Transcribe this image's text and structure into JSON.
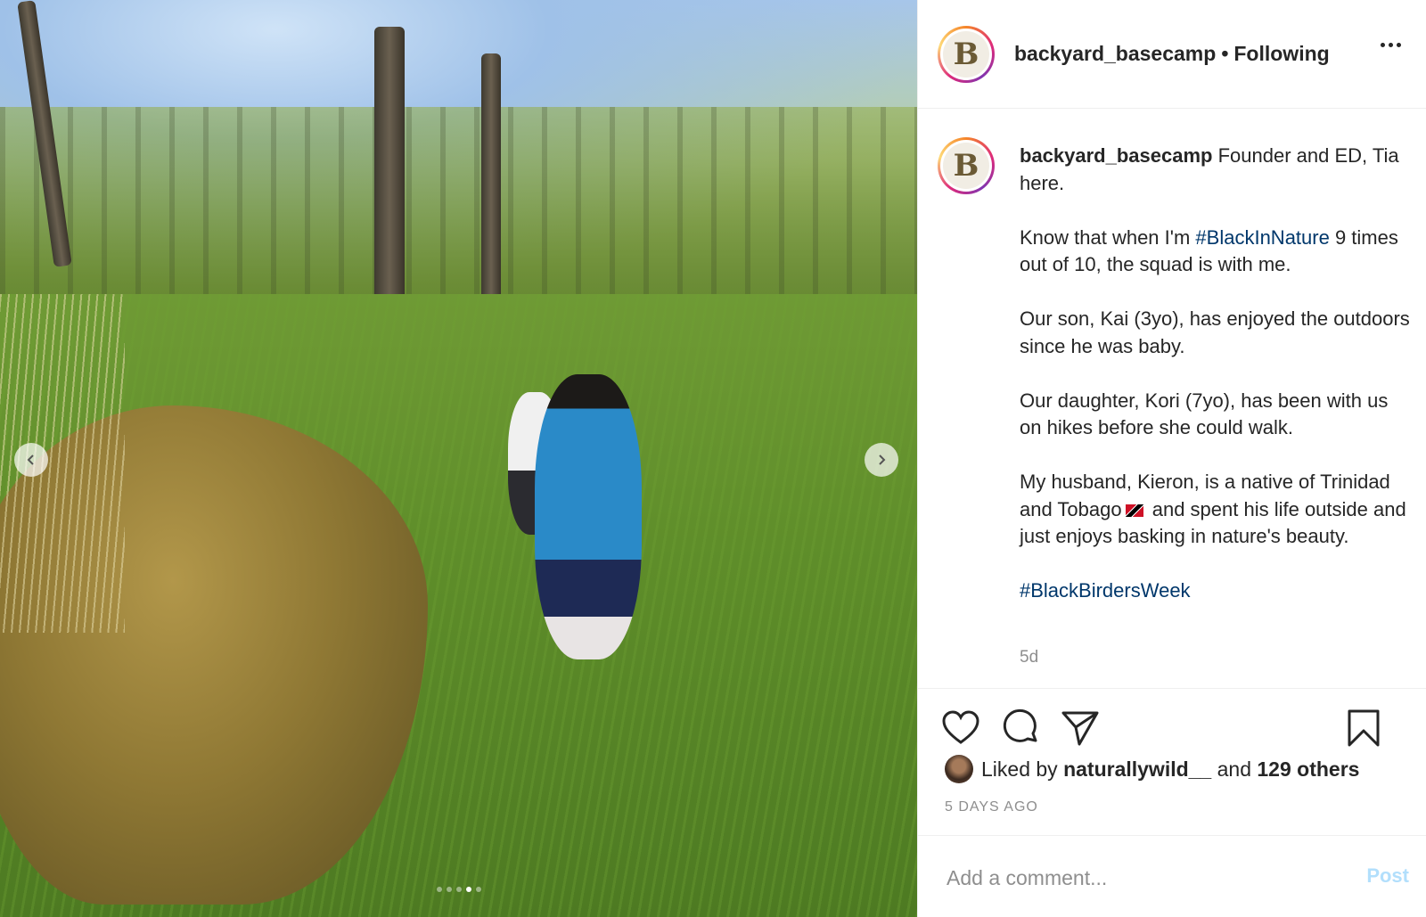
{
  "post": {
    "username": "backyard_basecamp",
    "separator": "•",
    "follow_status": "Following",
    "avatar_letter": "B"
  },
  "caption": {
    "username": "backyard_basecamp",
    "intro": "Founder and ED, Tia here.",
    "p1_before": "Know that when I'm ",
    "p1_tag": "#BlackInNature",
    "p1_after": " 9 times out of 10, the squad is with me.",
    "p2": "Our son, Kai (3yo), has enjoyed the outdoors since he was baby.",
    "p3": "Our daughter, Kori (7yo), has been with us on hikes before she could walk.",
    "p4_before": "My husband, Kieron, is a native of Trinidad and Tobago",
    "p4_after": " and spent his life outside and just enjoys basking in nature's beauty.",
    "p5_tag": "#BlackBirdersWeek",
    "age": "5d"
  },
  "engagement": {
    "liked_prefix": "Liked by",
    "liker": "naturallywild__",
    "and": "and",
    "others": "129 others",
    "date": "5 DAYS AGO"
  },
  "comment": {
    "placeholder": "Add a comment...",
    "post_label": "Post"
  },
  "carousel": {
    "slide_count": 5,
    "active_index": 3
  },
  "colors": {
    "hashtag": "#00376b",
    "post_disabled": "#b2dffc",
    "muted": "#8e8e8e"
  }
}
